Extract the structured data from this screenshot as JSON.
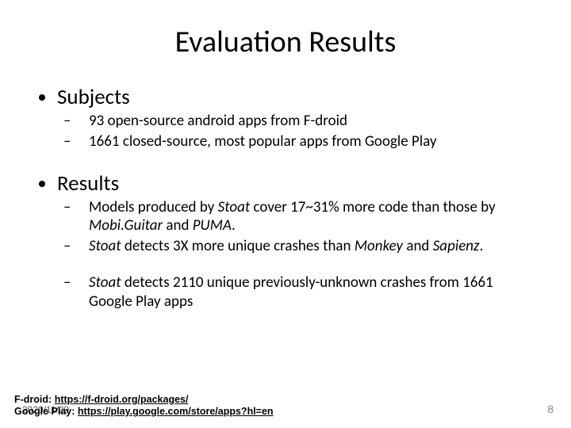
{
  "title": "Evaluation Results",
  "sections": [
    {
      "heading": "Subjects",
      "items": [
        {
          "parts": [
            {
              "t": "93 open-source android apps from F-droid"
            }
          ]
        },
        {
          "parts": [
            {
              "t": "1661 closed-source, most popular apps from Google Play"
            }
          ]
        }
      ]
    },
    {
      "heading": "Results",
      "items": [
        {
          "parts": [
            {
              "t": "Models produced by "
            },
            {
              "t": "Stoat",
              "em": true
            },
            {
              "t": " cover 17~31% more code than those by "
            },
            {
              "t": "Mobi.Guitar",
              "em": true
            },
            {
              "t": " and "
            },
            {
              "t": "PUMA",
              "em": true
            },
            {
              "t": "."
            }
          ]
        },
        {
          "parts": [
            {
              "t": "Stoat",
              "em": true
            },
            {
              "t": " detects 3X more unique crashes than "
            },
            {
              "t": "Monkey",
              "em": true
            },
            {
              "t": " and "
            },
            {
              "t": "Sapienz",
              "em": true
            },
            {
              "t": "."
            }
          ]
        },
        {
          "spacer": true
        },
        {
          "parts": [
            {
              "t": "Stoat",
              "em": true
            },
            {
              "t": " detects 2110 unique previously-unknown crashes from 1661 Google Play apps"
            }
          ]
        }
      ]
    }
  ],
  "footnotes": [
    {
      "label": "F-droid:",
      "url": "https://f-droid.org/packages/"
    },
    {
      "label": "Google Play:",
      "url": "https://play.google.com/store/apps?hl=en"
    }
  ],
  "date": "2020/11/29",
  "pagenum": "8"
}
